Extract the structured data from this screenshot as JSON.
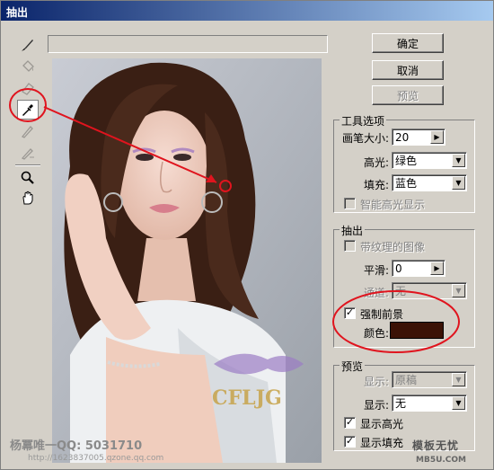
{
  "window": {
    "title": "抽出"
  },
  "toolbox": {
    "tools": [
      {
        "name": "edge-highlighter-tool",
        "icon": "brush-icon",
        "enabled": true
      },
      {
        "name": "fill-tool",
        "icon": "bucket-icon",
        "enabled": false
      },
      {
        "name": "eraser-tool",
        "icon": "eraser-icon",
        "enabled": false
      },
      {
        "name": "eyedropper-tool",
        "icon": "eyedropper-icon",
        "enabled": true,
        "selected": true
      },
      {
        "name": "cleanup-tool",
        "icon": "cleanup-icon",
        "enabled": false
      },
      {
        "name": "edge-touchup-tool",
        "icon": "touchup-icon",
        "enabled": false
      },
      {
        "name": "zoom-tool",
        "icon": "magnifier-icon",
        "enabled": true
      },
      {
        "name": "hand-tool",
        "icon": "hand-icon",
        "enabled": true
      }
    ]
  },
  "buttons": {
    "ok": "确定",
    "cancel": "取消",
    "preview": "预览"
  },
  "tool_options": {
    "title": "工具选项",
    "brush_size_label": "画笔大小:",
    "brush_size_value": "20",
    "highlight_label": "高光:",
    "highlight_value": "绿色",
    "fill_label": "填充:",
    "fill_value": "蓝色",
    "smart_highlight_label": "智能高光显示",
    "smart_highlight_checked": false
  },
  "extraction": {
    "title": "抽出",
    "textured_label": "带纹理的图像",
    "textured_checked": false,
    "smooth_label": "平滑:",
    "smooth_value": "0",
    "channel_label": "通道:",
    "channel_value": "无",
    "force_foreground_label": "强制前景",
    "force_foreground_checked": true,
    "color_label": "颜色:",
    "color_value": "#3b1206"
  },
  "preview_group": {
    "title": "预览",
    "show_label": "显示:",
    "show_value": "原稿",
    "display_label": "显示:",
    "display_value": "无",
    "show_highlight_label": "显示高光",
    "show_highlight_checked": true,
    "show_fill_label": "显示填充",
    "show_fill_checked": true
  },
  "watermarks": {
    "author": "杨冪唯一QQ: 5031710",
    "url": "http://1623837005.qzone.qq.com",
    "photo_mark": "CFLJG",
    "site_name": "模板无忧",
    "site_url": "MB5U.COM"
  },
  "colors": {
    "annotation_red": "#e0141e",
    "dialog_bg": "#d4d0c8"
  }
}
